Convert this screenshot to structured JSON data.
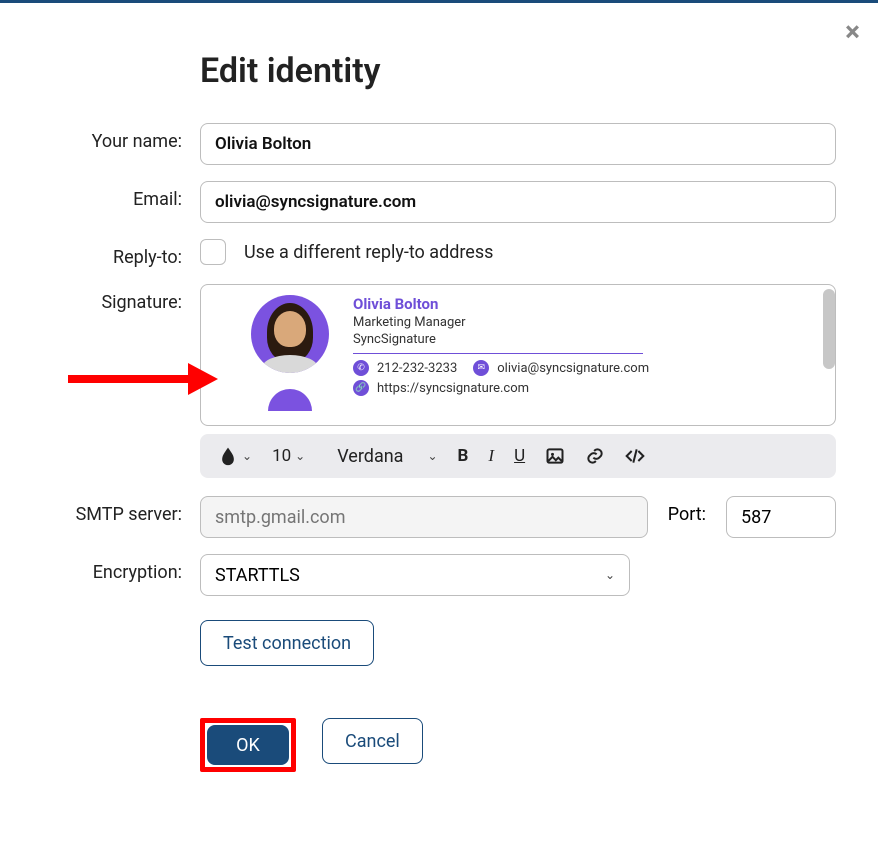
{
  "dialog": {
    "title": "Edit identity",
    "labels": {
      "your_name": "Your name:",
      "email": "Email:",
      "reply_to": "Reply-to:",
      "signature": "Signature:",
      "smtp": "SMTP server:",
      "port": "Port:",
      "encryption": "Encryption:"
    },
    "values": {
      "your_name": "Olivia Bolton",
      "email": "olivia@syncsignature.com",
      "reply_to_checkbox_label": "Use a different reply-to address",
      "smtp_placeholder": "smtp.gmail.com",
      "port": "587",
      "encryption": "STARTTLS"
    },
    "signature": {
      "name": "Olivia Bolton",
      "title": "Marketing Manager",
      "company": "SyncSignature",
      "phone": "212-232-3233",
      "email": "olivia@syncsignature.com",
      "url": "https://syncsignature.com"
    },
    "toolbar": {
      "font_size": "10",
      "font_name": "Verdana"
    },
    "buttons": {
      "test": "Test connection",
      "ok": "OK",
      "cancel": "Cancel"
    }
  }
}
